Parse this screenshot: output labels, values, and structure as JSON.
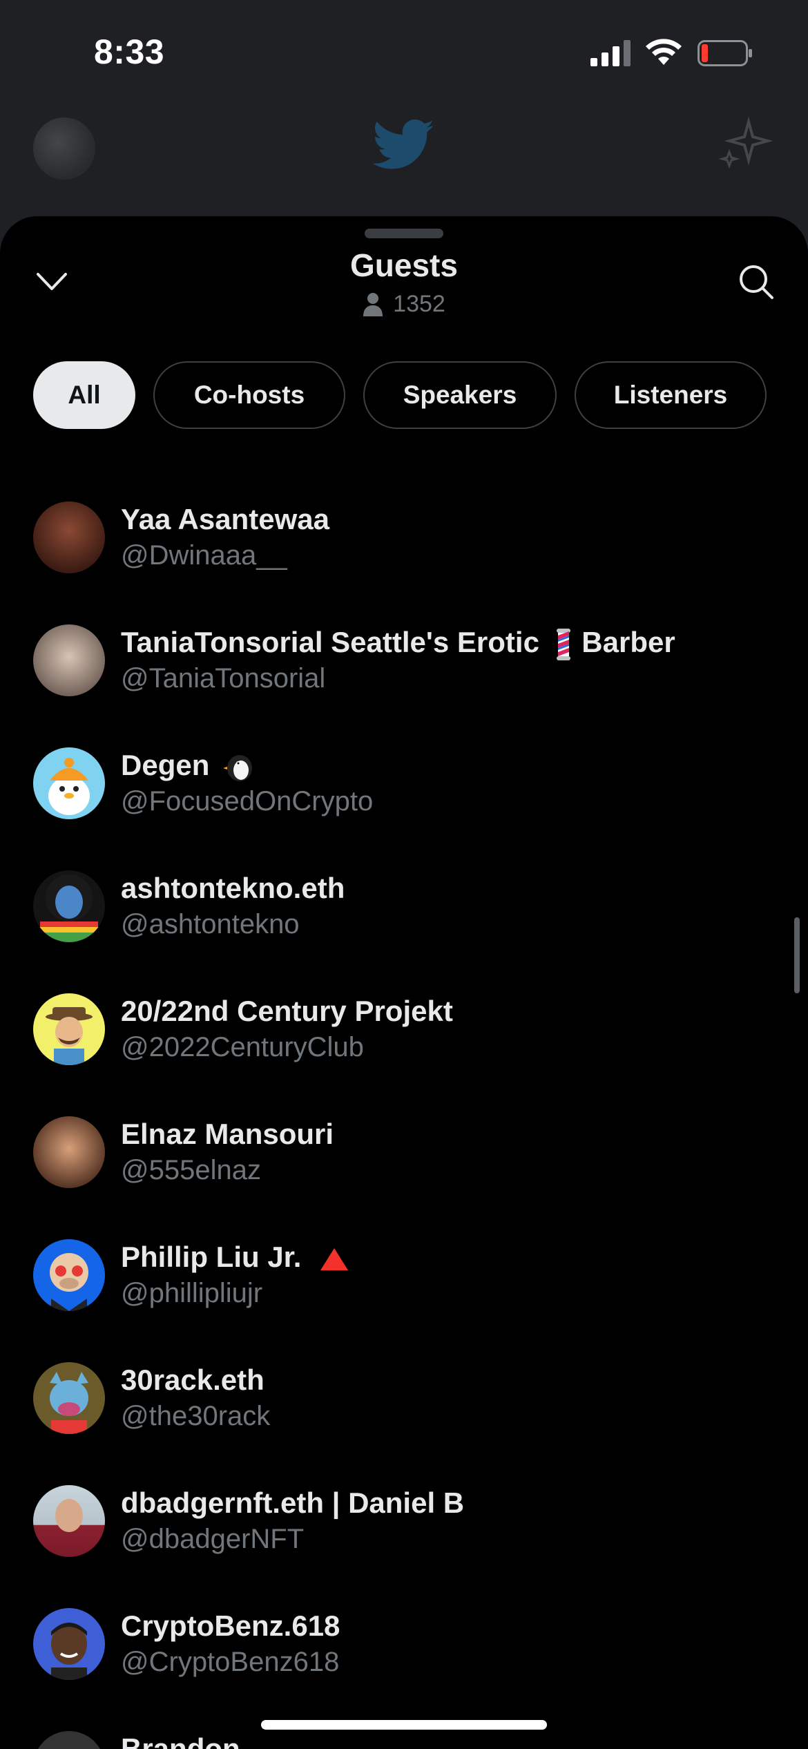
{
  "status": {
    "time": "8:33"
  },
  "sheet": {
    "title": "Guests",
    "count": "1352"
  },
  "filters": [
    {
      "label": "All",
      "active": true
    },
    {
      "label": "Co-hosts",
      "active": false
    },
    {
      "label": "Speakers",
      "active": false
    },
    {
      "label": "Listeners",
      "active": false
    }
  ],
  "guests": [
    {
      "name": "Yaa Asantewaa",
      "handle": "@Dwinaaa__",
      "avatar_color": "#5a2a1e"
    },
    {
      "name": "TaniaTonsorial Seattle's Erotic",
      "name_suffix": "Barber",
      "badge": "barber-pole-icon",
      "handle": "@TaniaTonsorial",
      "avatar_color": "#c9b8aa"
    },
    {
      "name": "Degen",
      "badge": "penguin-icon",
      "handle": "@FocusedOnCrypto",
      "avatar_color": "#7fd3f0"
    },
    {
      "name": "ashtontekno.eth",
      "handle": "@ashtontekno",
      "avatar_color": "#2c2c2c"
    },
    {
      "name": "20/22nd Century Projekt",
      "handle": "@2022CenturyClub",
      "avatar_color": "#f2ef6a"
    },
    {
      "name": "Elnaz Mansouri",
      "handle": "@555elnaz",
      "avatar_color": "#8a5a3c"
    },
    {
      "name": "Phillip Liu Jr.",
      "badge": "red-triangle-icon",
      "handle": "@phillipliujr",
      "avatar_color": "#1565e8"
    },
    {
      "name": "30rack.eth",
      "handle": "@the30rack",
      "avatar_color": "#6b5a2a"
    },
    {
      "name": "dbadgernft.eth | Daniel B",
      "handle": "@dbadgerNFT",
      "avatar_color": "#b8c4cc"
    },
    {
      "name": "CryptoBenz.618",
      "handle": "@CryptoBenz618",
      "avatar_color": "#3f5fd6"
    },
    {
      "name": "Brandon",
      "handle": "",
      "avatar_color": "#333333"
    }
  ]
}
